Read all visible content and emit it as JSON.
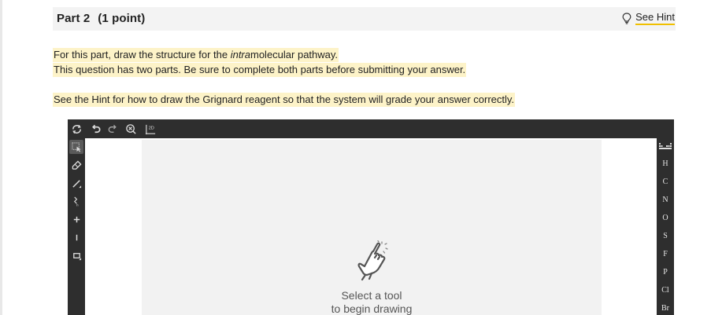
{
  "header": {
    "part_label": "Part 2",
    "points_label": "(1 point)",
    "hint_label": "See Hint",
    "hint_icon": "lightbulb-icon"
  },
  "question": {
    "line1_before": "For this part, draw the structure for the ",
    "line1_italic": "intra",
    "line1_after": "molecular pathway.",
    "line2": "This question has two parts. Be sure to complete both parts before submitting your answer.",
    "line3": "See the Hint for how to draw the Grignard reagent so that the system will grade your answer correctly."
  },
  "editor": {
    "top_tools": [
      "clear-icon",
      "undo-icon",
      "redo-icon",
      "zoom-icon",
      "2d-clean-icon"
    ],
    "top_tool_2d_label": "2D",
    "left_tools": [
      "select-icon",
      "erase-icon",
      "bond-icon",
      "chain-icon",
      "charge-plus-icon",
      "charge-minus-icon",
      "template-icon"
    ],
    "atoms": [
      "H",
      "C",
      "N",
      "O",
      "S",
      "F",
      "P",
      "Cl",
      "Br"
    ],
    "empty_state_line1": "Select a tool",
    "empty_state_line2": "to begin drawing",
    "colors": {
      "toolbar": "#2e2e2e",
      "canvas_area": "#f2f2f2",
      "highlight": "#fdf3c8",
      "hint_underline": "#f0c000"
    }
  }
}
